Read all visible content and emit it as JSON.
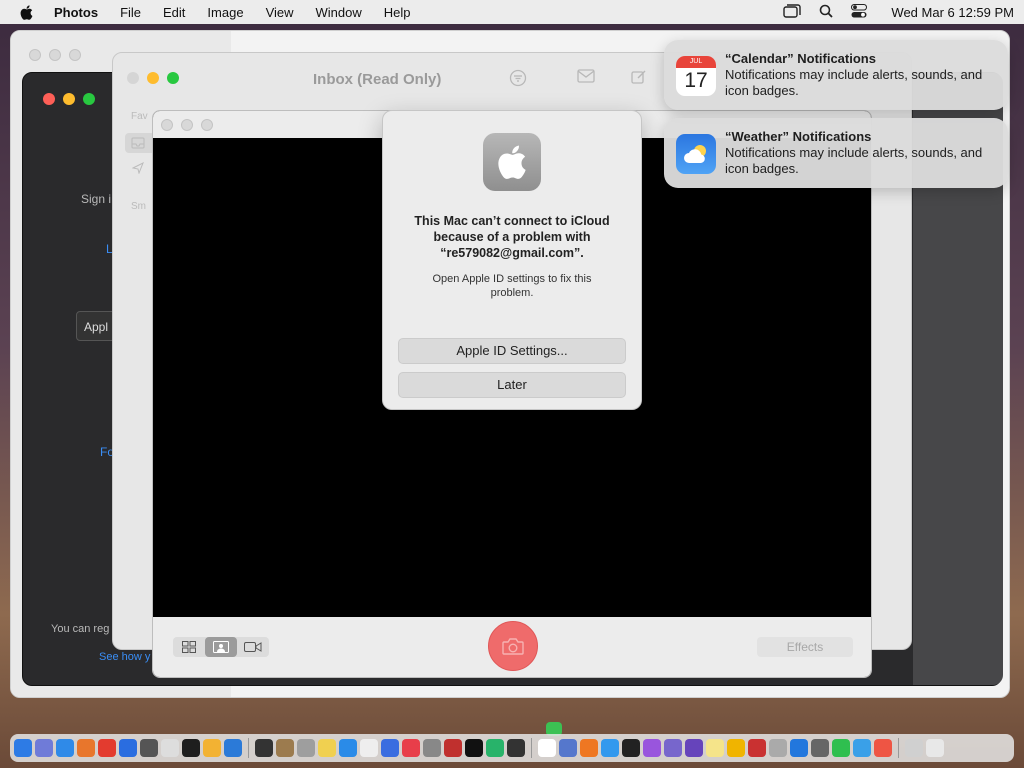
{
  "menubar": {
    "app_name": "Photos",
    "menus": [
      "File",
      "Edit",
      "Image",
      "View",
      "Window",
      "Help"
    ],
    "clock": "Wed Mar 6  12:59 PM",
    "status_icons": [
      "window-icon",
      "spotlight-search-icon",
      "control-center-icon"
    ]
  },
  "dark_window": {
    "sign_in_text": "Sign i",
    "link_l": "L",
    "field_text": "Appl",
    "link_fo": "Fo",
    "footer_text": "You can reg",
    "see_how_link": "See how y"
  },
  "mail_window": {
    "title": "Inbox (Read Only)",
    "side_favorites": "Fav",
    "side_smart": "Sm"
  },
  "photobooth": {
    "effects_label": "Effects"
  },
  "dialog": {
    "title": "This Mac can’t connect to iCloud because of a problem with “re579082@gmail.com”.",
    "body": "Open Apple ID settings to fix this problem.",
    "primary_button": "Apple ID Settings...",
    "secondary_button": "Later"
  },
  "notifications": [
    {
      "title": "“Calendar” Notifications",
      "body": "Notifications may include alerts, sounds, and icon badges.",
      "icon_month": "JUL",
      "icon_day": "17",
      "icon": "calendar-icon"
    },
    {
      "title": "“Weather” Notifications",
      "body": "Notifications may include alerts, sounds, and icon badges.",
      "icon": "weather-icon"
    }
  ],
  "dock": {
    "apps_left": [
      "#2d7be5",
      "#6f7bd8",
      "#2f8ae8",
      "#e8762c",
      "#e33b2f",
      "#2a6de0",
      "#555555",
      "#dddddd",
      "#1e1e1e",
      "#f2b233",
      "#2b7ad8"
    ],
    "apps_mid": [
      "#333333",
      "#9c7b4e",
      "#9e9e9e",
      "#f0d050",
      "#2a8be8",
      "#eeeeee",
      "#3a6de0",
      "#e83e4a",
      "#888888",
      "#c0302e",
      "#111111",
      "#28b36a",
      "#333333"
    ],
    "apps_right": [
      "#ffffff",
      "#5577cc",
      "#ee7722",
      "#3399ee",
      "#222222",
      "#9955dd",
      "#7766cc",
      "#6644bb",
      "#f5e48a",
      "#f0b400",
      "#c93131",
      "#aaaaaa",
      "#2277dd",
      "#666666",
      "#2fbf4f",
      "#3aa0e8",
      "#ee5544"
    ],
    "apps_trash": [
      "#d0d0d0",
      "#e8e8e8"
    ]
  }
}
